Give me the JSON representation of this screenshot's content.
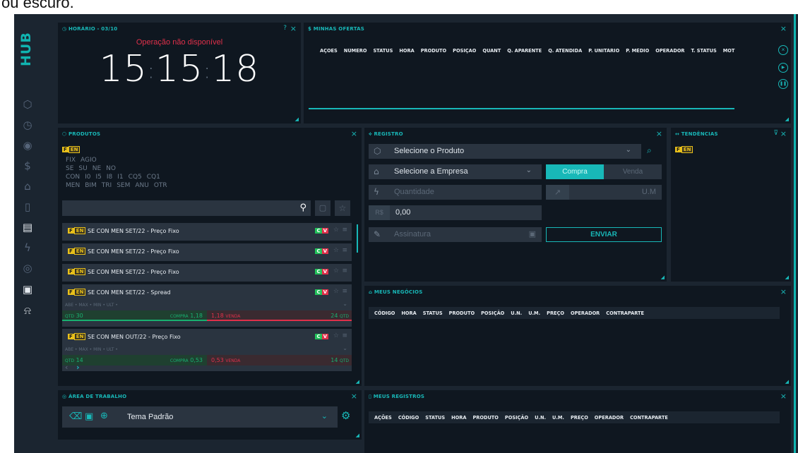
{
  "caption": "ou escuro.",
  "sidebar": {
    "logo": "HUB",
    "icons": [
      {
        "name": "cube-icon",
        "glyph": "⬡"
      },
      {
        "name": "clock-icon",
        "glyph": "◷"
      },
      {
        "name": "eye-icon",
        "glyph": "◉"
      },
      {
        "name": "dollar-icon",
        "glyph": "$"
      },
      {
        "name": "building-icon",
        "glyph": "⌂"
      },
      {
        "name": "book-icon",
        "glyph": "▯"
      },
      {
        "name": "document-icon",
        "glyph": "▤"
      },
      {
        "name": "lightning-icon",
        "glyph": "ϟ"
      },
      {
        "name": "broadcast-icon",
        "glyph": "◎"
      },
      {
        "name": "wallet-icon",
        "glyph": "▣"
      },
      {
        "name": "bell-icon",
        "glyph": "⍾"
      }
    ]
  },
  "horario": {
    "title": "HORÁRIO - 03/10",
    "status": "Operação não disponível",
    "time_h": "15",
    "time_m": "15",
    "time_s": "18"
  },
  "ofertas": {
    "title": "MINHAS OFERTAS",
    "columns": [
      "AÇÕES",
      "NÚMERO",
      "STATUS",
      "HORA",
      "PRODUTO",
      "POSIÇÃO",
      "QUANT",
      "Q. APARENTE",
      "Q. ATENDIDA",
      "P. UNITÁRIO",
      "P. MÉDIO",
      "OPERADOR",
      "T. STATUS",
      "MOT"
    ]
  },
  "produtos": {
    "title": "PRODUTOS",
    "chip_rows": [
      [
        "FIX",
        "AGIO"
      ],
      [
        "SE",
        "SU",
        "NE",
        "NO"
      ],
      [
        "CON",
        "I0",
        "I5",
        "I8",
        "I1",
        "CQ5",
        "CQ1"
      ],
      [
        "MEN",
        "BIM",
        "TRI",
        "SEM",
        "ANU",
        "OTR"
      ]
    ],
    "badge_f": "F",
    "badge_en": "EN",
    "items": [
      {
        "name": "SE CON MEN SET/22 - Preço Fixo"
      },
      {
        "name": "SE CON MEN SET/22 - Preço Fixo"
      },
      {
        "name": "SE CON MEN SET/22 - Preço Fixo"
      }
    ],
    "expanded": [
      {
        "name": "SE CON MEN SET/22 - Spread",
        "sub": "ABE • MAX • MIN • ULT •",
        "qtd_label": "QTD",
        "qtd_buy": "30",
        "compra_label": "COMPRA",
        "compra": "1,18",
        "venda": "1,18",
        "venda_label": "VENDA",
        "qtd_sell": "24",
        "qtd_label2": "QTD"
      },
      {
        "name": "SE CON MEN OUT/22 - Preço Fixo",
        "sub": "ABE • MAX • MIN • ULT •",
        "qtd_label": "QTD",
        "qtd_buy": "14",
        "compra_label": "COMPRA",
        "compra": "0,53",
        "venda": "0,53",
        "venda_label": "VENDA",
        "qtd_sell": "14",
        "qtd_label2": "QTD"
      }
    ],
    "c_label": "C",
    "v_label": "V"
  },
  "registro": {
    "title": "REGISTRO",
    "produto_placeholder": "Selecione o Produto",
    "empresa_placeholder": "Selecione a Empresa",
    "compra": "Compra",
    "venda": "Venda",
    "quantidade": "Quantidade",
    "um": "U.M",
    "currency": "R$",
    "price": "0,00",
    "assinatura": "Assinatura",
    "enviar": "ENVIAR"
  },
  "tendencias": {
    "title": "TENDÊNCIAS"
  },
  "negocios": {
    "title": "MEUS NEGÓCIOS",
    "columns": [
      "CÓDIGO",
      "HORA",
      "STATUS",
      "PRODUTO",
      "POSIÇÃO",
      "U.N.",
      "U.M.",
      "PREÇO",
      "OPERADOR",
      "CONTRAPARTE"
    ]
  },
  "area": {
    "title": "ÁREA DE TRABALHO",
    "theme": "Tema Padrão"
  },
  "registros": {
    "title": "MEUS REGISTROS",
    "columns": [
      "AÇÕES",
      "CÓDIGO",
      "STATUS",
      "HORA",
      "PRODUTO",
      "POSIÇÃO",
      "U.N.",
      "U.M.",
      "PREÇO",
      "OPERADOR",
      "CONTRAPARTE"
    ]
  },
  "colors": {
    "accent": "#18b8b8",
    "background": "#1b2530",
    "panel": "#0f1720",
    "buy": "#22c05a",
    "sell": "#e0304a",
    "badge": "#e8c01a"
  }
}
